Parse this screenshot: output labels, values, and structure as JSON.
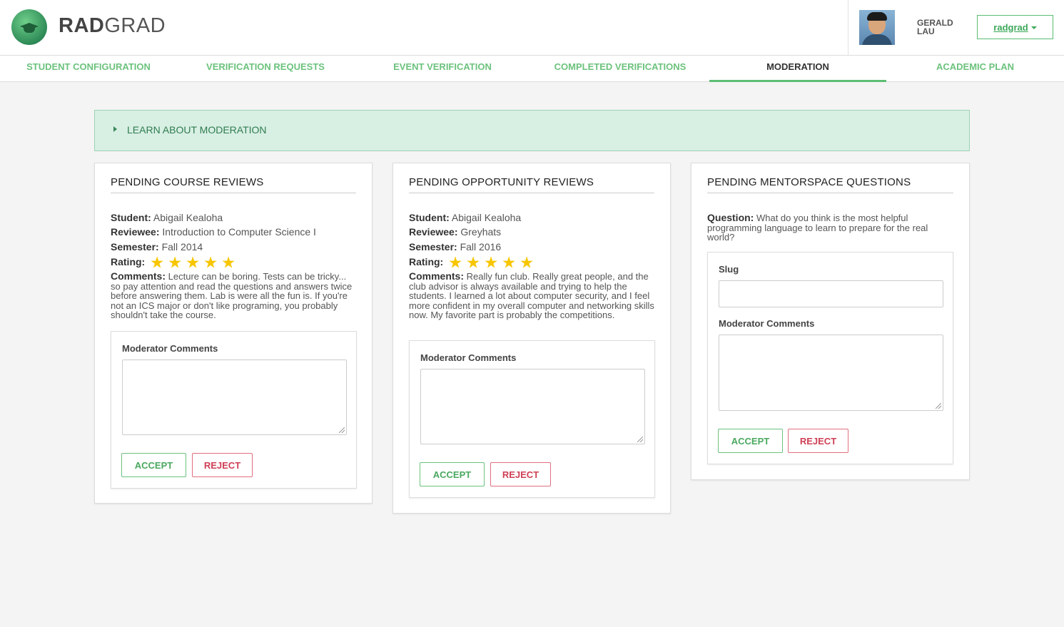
{
  "header": {
    "brand_bold": "RAD",
    "brand_rest": "GRAD",
    "user_name": "GERALD LAU",
    "user_button": "radgrad"
  },
  "tabs": [
    {
      "label": "STUDENT CONFIGURATION",
      "active": false
    },
    {
      "label": "VERIFICATION REQUESTS",
      "active": false
    },
    {
      "label": "EVENT VERIFICATION",
      "active": false
    },
    {
      "label": "COMPLETED VERIFICATIONS",
      "active": false
    },
    {
      "label": "MODERATION",
      "active": true
    },
    {
      "label": "ACADEMIC PLAN",
      "active": false
    }
  ],
  "learn": {
    "label": "LEARN ABOUT MODERATION"
  },
  "course_reviews": {
    "title": "PENDING COURSE REVIEWS",
    "student_label": "Student:",
    "student": "Abigail Kealoha",
    "reviewee_label": "Reviewee:",
    "reviewee": "Introduction to Computer Science I",
    "semester_label": "Semester:",
    "semester": "Fall 2014",
    "rating_label": "Rating:",
    "rating": 5,
    "comments_label": "Comments:",
    "comments": "Lecture can be boring. Tests can be tricky... so pay attention and read the questions and answers twice before answering them. Lab is were all the fun is. If you're not an ICS major or don't like programing, you probably shouldn't take the course.",
    "moderator_label": "Moderator Comments",
    "moderator_value": "",
    "accept": "ACCEPT",
    "reject": "REJECT"
  },
  "opportunity_reviews": {
    "title": "PENDING OPPORTUNITY REVIEWS",
    "student_label": "Student:",
    "student": "Abigail Kealoha",
    "reviewee_label": "Reviewee:",
    "reviewee": "Greyhats",
    "semester_label": "Semester:",
    "semester": "Fall 2016",
    "rating_label": "Rating:",
    "rating": 5,
    "comments_label": "Comments:",
    "comments": "Really fun club. Really great people, and the club advisor is always available and trying to help the students. I learned a lot about computer security, and I feel more confident in my overall computer and networking skills now. My favorite part is probably the competitions.",
    "moderator_label": "Moderator Comments",
    "moderator_value": "",
    "accept": "ACCEPT",
    "reject": "REJECT"
  },
  "mentorspace": {
    "title": "PENDING MENTORSPACE QUESTIONS",
    "question_label": "Question:",
    "question": "What do you think is the most helpful programming language to learn to prepare for the real world?",
    "slug_label": "Slug",
    "slug_value": "",
    "moderator_label": "Moderator Comments",
    "moderator_value": "",
    "accept": "ACCEPT",
    "reject": "REJECT"
  },
  "colors": {
    "accent_green": "#5bbd72",
    "reject_red": "#cf3f55",
    "learn_bg": "#d8efe4",
    "star_yellow": "#f7c600"
  },
  "icons": [
    "radgrad-logo",
    "user-avatar",
    "chevron-down-icon",
    "expand-arrow-icon",
    "star-icon",
    "resize-grip-icon"
  ]
}
